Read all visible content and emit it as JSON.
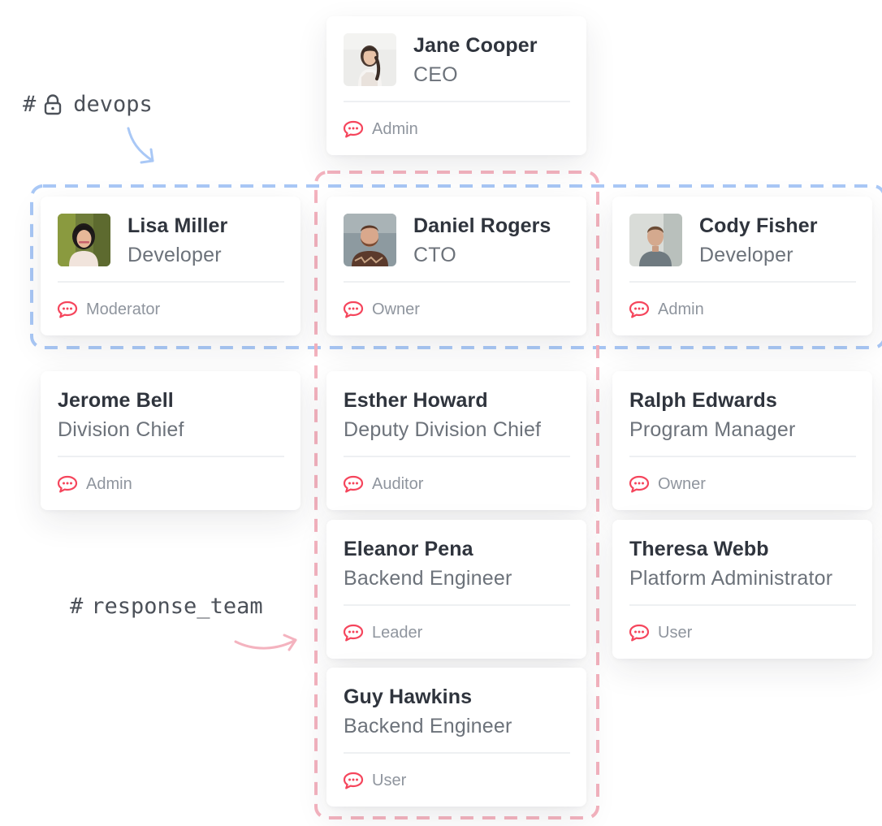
{
  "channels": {
    "devops": {
      "hash": "#",
      "name": "devops",
      "private": true,
      "color": "#9ec2f7"
    },
    "response_team": {
      "hash": "#",
      "name": "response_team",
      "private": false,
      "color": "#f2a6b4"
    }
  },
  "colors": {
    "chat_icon": "#f5455c",
    "name_text": "#2f343d",
    "role_text": "#6c727a",
    "tag_text": "#8f959e"
  },
  "cards": [
    {
      "name": "Jane Cooper",
      "role": "CEO",
      "tag": "Admin",
      "avatar": true
    },
    {
      "name": "Lisa Miller",
      "role": "Developer",
      "tag": "Moderator",
      "avatar": true
    },
    {
      "name": "Daniel Rogers",
      "role": "CTO",
      "tag": "Owner",
      "avatar": true
    },
    {
      "name": "Cody Fisher",
      "role": "Developer",
      "tag": "Admin",
      "avatar": true
    },
    {
      "name": "Jerome Bell",
      "role": "Division Chief",
      "tag": "Admin",
      "avatar": false
    },
    {
      "name": "Esther Howard",
      "role": "Deputy Division Chief",
      "tag": "Auditor",
      "avatar": false
    },
    {
      "name": "Ralph Edwards",
      "role": "Program Manager",
      "tag": "Owner",
      "avatar": false
    },
    {
      "name": "Eleanor Pena",
      "role": "Backend Engineer",
      "tag": "Leader",
      "avatar": false
    },
    {
      "name": "Theresa Webb",
      "role": "Platform Administrator",
      "tag": "User",
      "avatar": false
    },
    {
      "name": "Guy Hawkins",
      "role": "Backend Engineer",
      "tag": "User",
      "avatar": false
    }
  ]
}
